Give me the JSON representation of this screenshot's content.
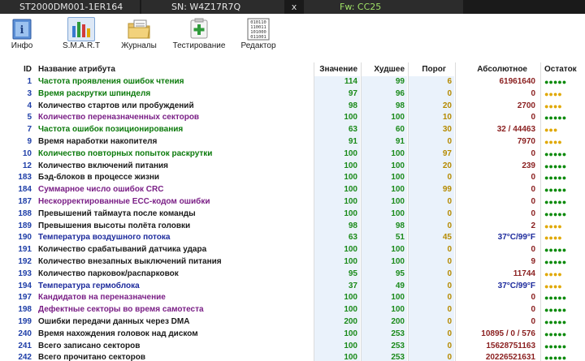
{
  "titlebar": {
    "model": "ST2000DM001-1ER164",
    "serial": "SN: W4Z17R7Q",
    "close": "x",
    "firmware": "Fw: CC25"
  },
  "toolbar": {
    "items": [
      {
        "label": "Инфо",
        "icon": "info-icon"
      },
      {
        "label": "S.M.A.R.T",
        "icon": "smart-chart-icon"
      },
      {
        "label": "Журналы",
        "icon": "logs-folder-icon"
      },
      {
        "label": "Тестирование",
        "icon": "test-plus-icon"
      },
      {
        "label": "Редактор",
        "icon": "binary-editor-icon"
      }
    ],
    "editor_icon_text": [
      "010110",
      "110011",
      "101000",
      "011001"
    ]
  },
  "table": {
    "headers": {
      "id": "ID",
      "name": "Название атрибута",
      "value": "Значение",
      "worst": "Худшее",
      "threshold": "Порог",
      "absolute": "Абсолютное",
      "remaining": "Остаток"
    },
    "colors": {
      "green": "#0b7a0b",
      "purple": "#7a1f86",
      "blue": "#1c2a9c",
      "black": "#1a1a1a",
      "value_green": "#1a8a1a",
      "value_blue": "#1c2a9c",
      "threshold_gold": "#b58a00",
      "dot_green": "#0a8a0a",
      "dot_yellow": "#e0a800"
    },
    "rows": [
      {
        "id": "1",
        "name": "Частота проявления ошибок чтения",
        "nc": "green",
        "val": "114",
        "worst": "99",
        "thr": "6",
        "abs": "61961640",
        "dots": "●●●●●",
        "dc": "green",
        "vc": "value_green"
      },
      {
        "id": "3",
        "name": "Время раскрутки шпинделя",
        "nc": "green",
        "val": "97",
        "worst": "96",
        "thr": "0",
        "abs": "0",
        "dots": "●●●●",
        "dc": "yellow",
        "vc": "value_green"
      },
      {
        "id": "4",
        "name": "Количество стартов или пробуждений",
        "nc": "black",
        "val": "98",
        "worst": "98",
        "thr": "20",
        "abs": "2700",
        "dots": "●●●●",
        "dc": "yellow",
        "vc": "value_green"
      },
      {
        "id": "5",
        "name": "Количество переназначенных секторов",
        "nc": "purple",
        "val": "100",
        "worst": "100",
        "thr": "10",
        "abs": "0",
        "dots": "●●●●●",
        "dc": "green",
        "vc": "value_green"
      },
      {
        "id": "7",
        "name": "Частота ошибок позиционирования",
        "nc": "green",
        "val": "63",
        "worst": "60",
        "thr": "30",
        "abs": "32 / 44463",
        "dots": "●●●",
        "dc": "yellow",
        "vc": "value_green"
      },
      {
        "id": "9",
        "name": "Время наработки накопителя",
        "nc": "black",
        "val": "91",
        "worst": "91",
        "thr": "0",
        "abs": "7970",
        "dots": "●●●●",
        "dc": "yellow",
        "vc": "value_green"
      },
      {
        "id": "10",
        "name": "Количество повторных попыток раскрутки",
        "nc": "green",
        "val": "100",
        "worst": "100",
        "thr": "97",
        "abs": "0",
        "dots": "●●●●●",
        "dc": "green",
        "vc": "value_green"
      },
      {
        "id": "12",
        "name": "Количество включений питания",
        "nc": "black",
        "val": "100",
        "worst": "100",
        "thr": "20",
        "abs": "239",
        "dots": "●●●●●",
        "dc": "green",
        "vc": "value_green"
      },
      {
        "id": "183",
        "name": "Бэд-блоков в процессе жизни",
        "nc": "black",
        "val": "100",
        "worst": "100",
        "thr": "0",
        "abs": "0",
        "dots": "●●●●●",
        "dc": "green",
        "vc": "value_green"
      },
      {
        "id": "184",
        "name": "Суммарное число ошибок CRC",
        "nc": "purple",
        "val": "100",
        "worst": "100",
        "thr": "99",
        "abs": "0",
        "dots": "●●●●●",
        "dc": "green",
        "vc": "value_green"
      },
      {
        "id": "187",
        "name": "Нескорректированные ECC-кодом ошибки",
        "nc": "purple",
        "val": "100",
        "worst": "100",
        "thr": "0",
        "abs": "0",
        "dots": "●●●●●",
        "dc": "green",
        "vc": "value_green"
      },
      {
        "id": "188",
        "name": "Превышений таймаута после команды",
        "nc": "black",
        "val": "100",
        "worst": "100",
        "thr": "0",
        "abs": "0",
        "dots": "●●●●●",
        "dc": "green",
        "vc": "value_green"
      },
      {
        "id": "189",
        "name": "Превышения высоты полёта головки",
        "nc": "black",
        "val": "98",
        "worst": "98",
        "thr": "0",
        "abs": "2",
        "dots": "●●●●",
        "dc": "yellow",
        "vc": "value_green"
      },
      {
        "id": "190",
        "name": "Температура воздушного потока",
        "nc": "blue",
        "val": "63",
        "worst": "51",
        "thr": "45",
        "abs": "37°C/99°F",
        "ac": "value_blue",
        "dots": "●●●●",
        "dc": "yellow",
        "vc": "value_green"
      },
      {
        "id": "191",
        "name": "Количество срабатываний датчика удара",
        "nc": "black",
        "val": "100",
        "worst": "100",
        "thr": "0",
        "abs": "0",
        "dots": "●●●●●",
        "dc": "green",
        "vc": "value_green"
      },
      {
        "id": "192",
        "name": "Количество внезапных выключений питания",
        "nc": "black",
        "val": "100",
        "worst": "100",
        "thr": "0",
        "abs": "9",
        "dots": "●●●●●",
        "dc": "green",
        "vc": "value_green"
      },
      {
        "id": "193",
        "name": "Количество парковок/распарковок",
        "nc": "black",
        "val": "95",
        "worst": "95",
        "thr": "0",
        "abs": "11744",
        "dots": "●●●●",
        "dc": "yellow",
        "vc": "value_green"
      },
      {
        "id": "194",
        "name": "Температура гермоблока",
        "nc": "blue",
        "val": "37",
        "worst": "49",
        "thr": "0",
        "abs": "37°C/99°F",
        "ac": "value_blue",
        "dots": "●●●●",
        "dc": "yellow",
        "vc": "value_green"
      },
      {
        "id": "197",
        "name": "Кандидатов на переназначение",
        "nc": "purple",
        "val": "100",
        "worst": "100",
        "thr": "0",
        "abs": "0",
        "dots": "●●●●●",
        "dc": "green",
        "vc": "value_green"
      },
      {
        "id": "198",
        "name": "Дефектные секторы во время самотеста",
        "nc": "purple",
        "val": "100",
        "worst": "100",
        "thr": "0",
        "abs": "0",
        "dots": "●●●●●",
        "dc": "green",
        "vc": "value_green"
      },
      {
        "id": "199",
        "name": "Ошибки передачи данных через DMA",
        "nc": "black",
        "val": "200",
        "worst": "200",
        "thr": "0",
        "abs": "0",
        "dots": "●●●●●",
        "dc": "green",
        "vc": "value_green"
      },
      {
        "id": "240",
        "name": "Время нахождения головок над диском",
        "nc": "black",
        "val": "100",
        "worst": "253",
        "thr": "0",
        "abs": "10895 / 0 / 576",
        "dots": "●●●●●",
        "dc": "green",
        "vc": "value_green"
      },
      {
        "id": "241",
        "name": "Всего записано секторов",
        "nc": "black",
        "val": "100",
        "worst": "253",
        "thr": "0",
        "abs": "15628751163",
        "dots": "●●●●●",
        "dc": "green",
        "vc": "value_green"
      },
      {
        "id": "242",
        "name": "Всего прочитано секторов",
        "nc": "black",
        "val": "100",
        "worst": "253",
        "thr": "0",
        "abs": "20226521631",
        "dots": "●●●●●",
        "dc": "green",
        "vc": "value_green"
      }
    ]
  }
}
